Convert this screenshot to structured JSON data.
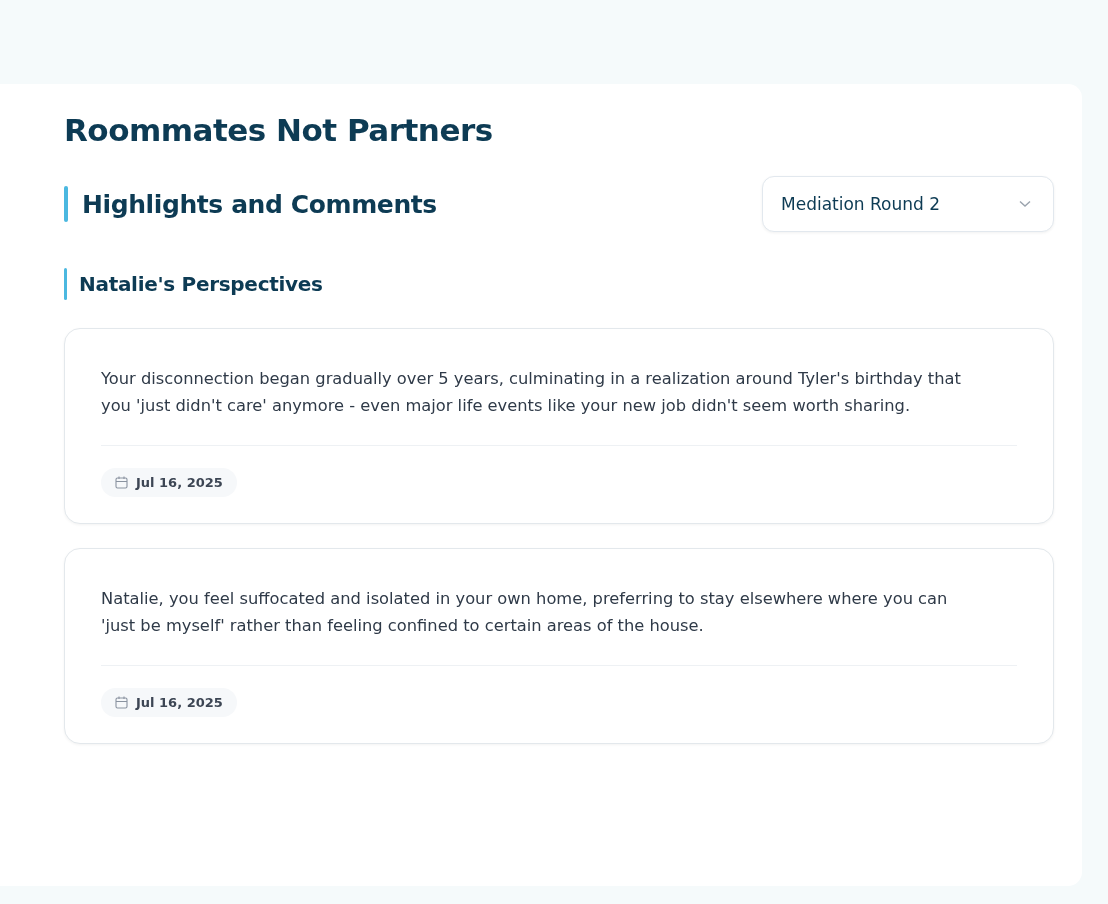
{
  "page": {
    "title": "Roommates Not Partners"
  },
  "section": {
    "title": "Highlights and Comments",
    "round_select": {
      "value": "Mediation Round 2"
    }
  },
  "group": {
    "title": "Natalie's Perspectives",
    "comments": [
      {
        "text": "Your disconnection began gradually over 5 years, culminating in a realization around Tyler's birthday that you 'just didn't care' anymore - even major life events like your new job didn't seem worth sharing.",
        "date": "Jul 16, 2025"
      },
      {
        "text": "Natalie, you feel suffocated and isolated in your own home, preferring to stay elsewhere where you can 'just be myself' rather than feeling confined to certain areas of the house.",
        "date": "Jul 16, 2025"
      }
    ]
  }
}
